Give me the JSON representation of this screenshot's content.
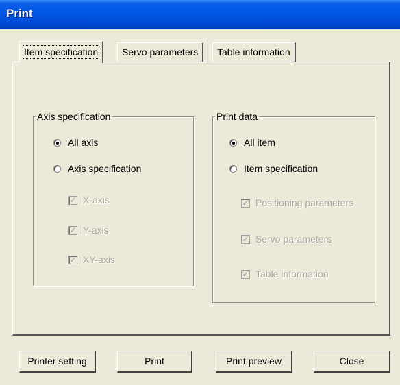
{
  "window": {
    "title": "Print"
  },
  "tabs": [
    {
      "label": "Item specification",
      "active": true
    },
    {
      "label": "Servo parameters",
      "active": false
    },
    {
      "label": "Table information",
      "active": false
    }
  ],
  "axis_group": {
    "legend": "Axis specification",
    "radios": [
      {
        "label": "All axis",
        "selected": true
      },
      {
        "label": "Axis specification",
        "selected": false
      }
    ],
    "checkboxes": [
      {
        "label": "X-axis",
        "checked": true,
        "enabled": false
      },
      {
        "label": "Y-axis",
        "checked": true,
        "enabled": false
      },
      {
        "label": "XY-axis",
        "checked": true,
        "enabled": false
      }
    ]
  },
  "print_group": {
    "legend": "Print data",
    "radios": [
      {
        "label": "All item",
        "selected": true
      },
      {
        "label": "Item specification",
        "selected": false
      }
    ],
    "checkboxes": [
      {
        "label": "Positioning parameters",
        "checked": true,
        "enabled": false
      },
      {
        "label": "Servo parameters",
        "checked": true,
        "enabled": false
      },
      {
        "label": "Table information",
        "checked": true,
        "enabled": false
      }
    ]
  },
  "buttons": {
    "printer_setting": "Printer setting",
    "print": "Print",
    "print_preview": "Print preview",
    "close": "Close"
  }
}
